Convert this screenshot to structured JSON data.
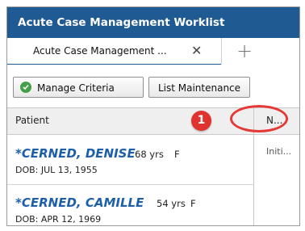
{
  "window": {
    "title": "Acute Case Management Worklist"
  },
  "tabs": [
    {
      "label": "Acute Case Management ...",
      "close_glyph": "✕"
    }
  ],
  "add_tab_glyph": "+",
  "toolbar": {
    "manage_criteria_label": "Manage Criteria",
    "list_maintenance_label": "List Maintenance"
  },
  "table": {
    "headers": {
      "patient": "Patient",
      "next": "N..."
    },
    "rows": [
      {
        "name": "*CERNED, DENISE",
        "age": "68 yrs",
        "sex": "F",
        "dob": "DOB: JUL 13, 1955",
        "next": "Initi..."
      },
      {
        "name": "*CERNED, CAMILLE",
        "age": "54 yrs",
        "sex": "F",
        "dob": "DOB: APR 12, 1969",
        "next": ""
      }
    ]
  },
  "annotation": {
    "step_number": "1"
  },
  "colors": {
    "titlebar": "#1f5a92",
    "patient_name": "#1d5fa8",
    "callout": "#e53935",
    "check": "#43a047"
  },
  "icons": {
    "check": "check-circle-icon",
    "close": "close-icon",
    "add": "plus-icon"
  }
}
